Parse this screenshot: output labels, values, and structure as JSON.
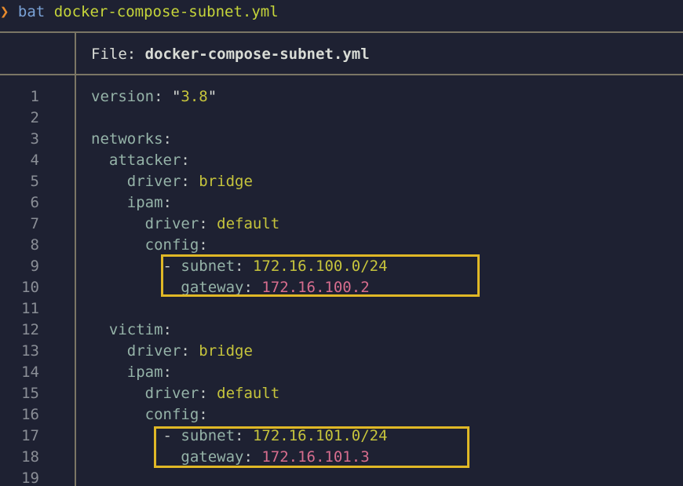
{
  "prompt": {
    "symbol": "❯",
    "command": "bat",
    "argument": "docker-compose-subnet.yml"
  },
  "header": {
    "label": "File:",
    "filename": "docker-compose-subnet.yml"
  },
  "lines": [
    {
      "n": "1",
      "indent": "",
      "tokens": [
        [
          "k",
          "version"
        ],
        [
          "p",
          ": "
        ],
        [
          "q",
          "\""
        ],
        [
          "s",
          "3.8"
        ],
        [
          "q",
          "\""
        ]
      ]
    },
    {
      "n": "2",
      "indent": "",
      "tokens": []
    },
    {
      "n": "3",
      "indent": "",
      "tokens": [
        [
          "k",
          "networks"
        ],
        [
          "p",
          ":"
        ]
      ]
    },
    {
      "n": "4",
      "indent": "  ",
      "tokens": [
        [
          "k",
          "attacker"
        ],
        [
          "p",
          ":"
        ]
      ]
    },
    {
      "n": "5",
      "indent": "    ",
      "tokens": [
        [
          "k",
          "driver"
        ],
        [
          "p",
          ": "
        ],
        [
          "s",
          "bridge"
        ]
      ]
    },
    {
      "n": "6",
      "indent": "    ",
      "tokens": [
        [
          "k",
          "ipam"
        ],
        [
          "p",
          ":"
        ]
      ]
    },
    {
      "n": "7",
      "indent": "      ",
      "tokens": [
        [
          "k",
          "driver"
        ],
        [
          "p",
          ": "
        ],
        [
          "s",
          "default"
        ]
      ]
    },
    {
      "n": "8",
      "indent": "      ",
      "tokens": [
        [
          "k",
          "config"
        ],
        [
          "p",
          ":"
        ]
      ]
    },
    {
      "n": "9",
      "indent": "        ",
      "tokens": [
        [
          "p",
          "- "
        ],
        [
          "k",
          "subnet"
        ],
        [
          "p",
          ": "
        ],
        [
          "s",
          "172.16.100.0/24"
        ]
      ]
    },
    {
      "n": "10",
      "indent": "          ",
      "tokens": [
        [
          "k",
          "gateway"
        ],
        [
          "p",
          ": "
        ],
        [
          "g",
          "172.16.100.2"
        ]
      ]
    },
    {
      "n": "11",
      "indent": "",
      "tokens": []
    },
    {
      "n": "12",
      "indent": "  ",
      "tokens": [
        [
          "k",
          "victim"
        ],
        [
          "p",
          ":"
        ]
      ]
    },
    {
      "n": "13",
      "indent": "    ",
      "tokens": [
        [
          "k",
          "driver"
        ],
        [
          "p",
          ": "
        ],
        [
          "s",
          "bridge"
        ]
      ]
    },
    {
      "n": "14",
      "indent": "    ",
      "tokens": [
        [
          "k",
          "ipam"
        ],
        [
          "p",
          ":"
        ]
      ]
    },
    {
      "n": "15",
      "indent": "      ",
      "tokens": [
        [
          "k",
          "driver"
        ],
        [
          "p",
          ": "
        ],
        [
          "s",
          "default"
        ]
      ]
    },
    {
      "n": "16",
      "indent": "      ",
      "tokens": [
        [
          "k",
          "config"
        ],
        [
          "p",
          ":"
        ]
      ]
    },
    {
      "n": "17",
      "indent": "        ",
      "tokens": [
        [
          "p",
          "- "
        ],
        [
          "k",
          "subnet"
        ],
        [
          "p",
          ": "
        ],
        [
          "s",
          "172.16.101.0/24"
        ]
      ]
    },
    {
      "n": "18",
      "indent": "          ",
      "tokens": [
        [
          "k",
          "gateway"
        ],
        [
          "p",
          ": "
        ],
        [
          "g",
          "172.16.101.3"
        ]
      ]
    },
    {
      "n": "19",
      "indent": "",
      "tokens": []
    }
  ],
  "colors": {
    "background": "#1e2132",
    "key": "#95b3a8",
    "string": "#c6c43c",
    "gateway_value": "#d76d8e",
    "highlight_box": "#e0b826",
    "rule": "#7b7665",
    "prompt_symbol": "#e88a2c",
    "prompt_command": "#7aa2d6",
    "prompt_argument": "#c6d53a"
  }
}
